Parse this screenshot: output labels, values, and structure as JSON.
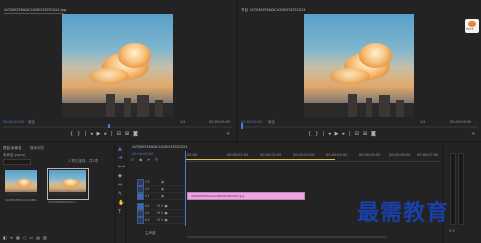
{
  "source_monitor": {
    "clip_name": "ULTIMATEMAXCLONESTATE2024.jpg",
    "timecode_left": "00:00:00:00",
    "fit": "适合",
    "fraction": "1/2",
    "timecode_right": "00:00:05:00"
  },
  "program_monitor": {
    "title": "节目",
    "sequence_name": "ULTIMATEMAXCLONESTATE2024",
    "timecode_left": "00:00:00:00",
    "fit": "适合",
    "fraction": "1/2",
    "timecode_right": "00:00:05:00"
  },
  "project_panel": {
    "tab_project": "项目:未命名",
    "tab_media": "媒体浏览",
    "folder": "未命名.prproj",
    "items_count": "1 项已选择，共2项",
    "thumbnails": [
      {
        "label": "ULTIMATEMAXCLONE..."
      },
      {
        "label": "ULTIMATEMAXCLO..."
      }
    ]
  },
  "timeline": {
    "sequence_tab": "ULTIMATEMAXCLONESTATE2024",
    "timecode": "00:00:00:00",
    "ruler_labels": [
      "00:00",
      "00:00:01:00",
      "00:00:02:00",
      "00:00:03:00",
      "00:00:04:00",
      "00:00:05:00",
      "00:00:06:00",
      "00:00:07:00"
    ],
    "video_tracks": [
      "V3",
      "V2",
      "V1"
    ],
    "audio_tracks": [
      "A1",
      "A2",
      "A3"
    ],
    "master": "主声道",
    "clip_label": "ULTIMATEMAXCLONESTATE2024.jpg",
    "clip_color": "#e9a6e0"
  },
  "logo": "ESTE",
  "watermark": "最需教育"
}
